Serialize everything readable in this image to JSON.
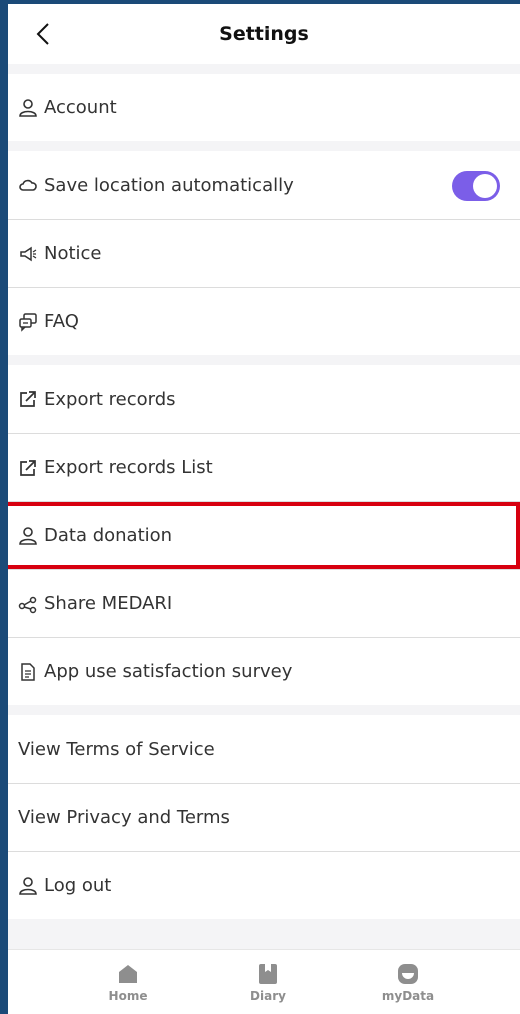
{
  "header": {
    "title": "Settings"
  },
  "account": {
    "label": "Account"
  },
  "group2": {
    "save_location": "Save location automatically",
    "save_location_enabled": true,
    "notice": "Notice",
    "faq": "FAQ"
  },
  "group3": {
    "export_records": "Export records",
    "export_records_list": "Export records List",
    "data_donation": "Data donation",
    "share": "Share MEDARI",
    "survey": "App use satisfaction survey"
  },
  "group4": {
    "terms": "View Terms of Service",
    "privacy": "View Privacy and Terms",
    "logout": "Log out"
  },
  "nav": {
    "home": "Home",
    "diary": "Diary",
    "mydata": "myData"
  },
  "colors": {
    "accent": "#7b5ee8",
    "highlight": "#d7000f",
    "frame": "#1b4a78"
  }
}
